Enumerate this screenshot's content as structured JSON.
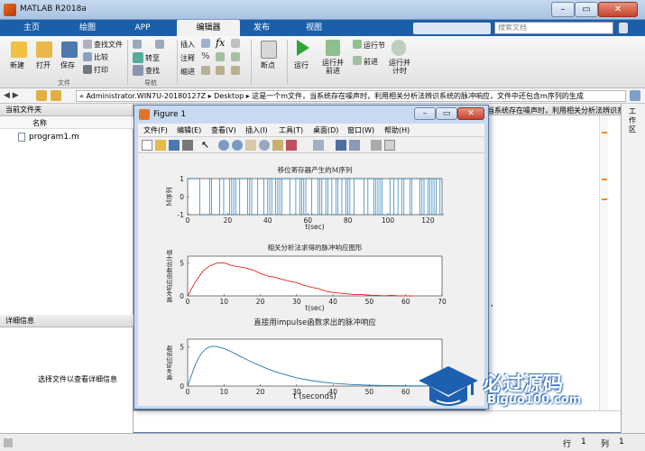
{
  "window": {
    "title": "MATLAB R2018a"
  },
  "tabs": [
    {
      "label": "主页"
    },
    {
      "label": "绘图"
    },
    {
      "label": "APP"
    },
    {
      "label": "编辑器"
    },
    {
      "label": "发布"
    },
    {
      "label": "视图"
    }
  ],
  "search": {
    "placeholder": "搜索文档"
  },
  "toolstrip": {
    "new": "新建",
    "open": "打开",
    "save": "保存",
    "find_files": "查找文件",
    "compare": "比较",
    "print": "打印",
    "file_group": "文件",
    "insert": "插入",
    "comment": "注释",
    "indent": "缩进",
    "goto": "转至",
    "find": "查找",
    "nav_group": "导航",
    "breakpoints": "断点",
    "run": "运行",
    "run_advance": "运行并\n前进",
    "run_section": "运行节",
    "advance": "前进",
    "run_time": "运行并\n计时"
  },
  "address": {
    "path": "« Administrator.WIN7U-20180127Z ▸ Desktop ▸ 这是一个m文件，当系统存在噪声时，利用相关分析法辨识系统的脉冲响应，文件中还包含m序列的生成"
  },
  "current_folder": {
    "title": "当前文件夹",
    "name_col": "名称",
    "file": "program1.m"
  },
  "details": {
    "title": "详细信息",
    "hint": "选择文件以查看详细信息"
  },
  "editor_tail": {
    "title_text": "当系统存在噪声时，利用相关分析法辨识系...",
    "comma": ","
  },
  "workspace": {
    "title": "工作区"
  },
  "status": {
    "row_label": "行",
    "row": "1",
    "col_label": "列",
    "col": "1"
  },
  "figure": {
    "title": "Figure 1",
    "menu": [
      "文件(F)",
      "编辑(E)",
      "查看(V)",
      "插入(I)",
      "工具(T)",
      "桌面(D)",
      "窗口(W)",
      "帮助(H)"
    ]
  },
  "watermark": {
    "brand": "必过源码",
    "url": "Biguo100.com"
  },
  "chart_data": [
    {
      "type": "line",
      "title": "移位寄存器产生的M序列",
      "xlabel": "t(sec)",
      "ylabel": "M序列",
      "xlim": [
        0,
        127
      ],
      "ylim": [
        -1,
        1
      ],
      "xticks": [
        0,
        20,
        40,
        60,
        80,
        100,
        120
      ],
      "yticks": [
        -1,
        0,
        1
      ],
      "color": "#1f77b4",
      "values": [
        1,
        1,
        1,
        1,
        1,
        1,
        -1,
        -1,
        -1,
        -1,
        -1,
        1,
        -1,
        -1,
        -1,
        -1,
        1,
        1,
        -1,
        -1,
        -1,
        1,
        -1,
        1,
        -1,
        -1,
        1,
        1,
        1,
        1,
        -1,
        1,
        -1,
        -1,
        -1,
        1,
        1,
        1,
        -1,
        -1,
        1,
        -1,
        1,
        1,
        -1,
        1,
        -1,
        1,
        1,
        1,
        1,
        -1,
        -1,
        -1,
        1,
        1,
        -1,
        1,
        -1,
        1,
        1,
        1,
        -1,
        -1,
        -1,
        1,
        -1,
        1,
        1,
        -1,
        1,
        1,
        -1,
        -1,
        1,
        -1,
        -1,
        1,
        1,
        -1,
        1,
        -1,
        -1,
        1,
        1,
        1,
        1,
        1,
        -1,
        -1,
        1,
        1,
        1,
        -1,
        1,
        -1,
        1,
        -1,
        -1,
        -1,
        -1,
        1,
        1,
        -1,
        -1,
        1,
        1,
        -1,
        1,
        1,
        1,
        -1,
        1,
        1,
        1,
        1,
        -1,
        1,
        -1,
        -1,
        1,
        -1,
        1,
        -1,
        1,
        1,
        -1,
        -1
      ]
    },
    {
      "type": "line",
      "title": "相关分析法求得的脉冲响应图形",
      "xlabel": "t(sec)",
      "ylabel": "脉冲响应函数估计值",
      "xlim": [
        0,
        70
      ],
      "ylim": [
        0,
        6
      ],
      "xticks": [
        0,
        10,
        20,
        30,
        40,
        50,
        60,
        70
      ],
      "yticks": [
        0,
        5
      ],
      "color": "#e8231b",
      "x": [
        0,
        2,
        4,
        5,
        6,
        8,
        10,
        12,
        14,
        16,
        18,
        20,
        22,
        24,
        26,
        28,
        30,
        32,
        34,
        36,
        38,
        40,
        42,
        44,
        46,
        48,
        50,
        52,
        54,
        56,
        58,
        60,
        62
      ],
      "y": [
        0,
        2.0,
        3.6,
        4.1,
        4.5,
        4.95,
        5.0,
        4.6,
        4.4,
        4.2,
        3.9,
        3.4,
        3.0,
        2.8,
        2.5,
        2.2,
        2.0,
        1.6,
        1.3,
        1.1,
        0.7,
        0.5,
        0.4,
        0.3,
        0.2,
        0.2,
        0.1,
        0.1,
        0.0,
        0.1,
        0.0,
        0.0,
        0.0
      ]
    },
    {
      "type": "line",
      "title": "直接用impulse函数求出的脉冲响应",
      "xlabel": "t (seconds)",
      "ylabel": "脉冲响应函数",
      "xlim": [
        0,
        70
      ],
      "ylim": [
        0,
        6
      ],
      "xticks": [
        0,
        10,
        20,
        30,
        40,
        50,
        60
      ],
      "yticks": [
        0,
        5
      ],
      "color": "#1f77b4",
      "x": [
        0,
        1,
        2,
        3,
        4,
        5,
        6,
        7,
        8,
        10,
        12,
        14,
        16,
        18,
        20,
        22,
        25,
        30,
        35,
        40,
        45,
        50,
        55,
        60,
        65,
        70
      ],
      "y": [
        0,
        1.3,
        2.6,
        3.6,
        4.3,
        4.75,
        5.0,
        5.1,
        5.05,
        4.8,
        4.4,
        3.9,
        3.45,
        3.0,
        2.6,
        2.2,
        1.7,
        1.05,
        0.62,
        0.35,
        0.2,
        0.11,
        0.06,
        0.03,
        0.02,
        0.01
      ]
    }
  ]
}
